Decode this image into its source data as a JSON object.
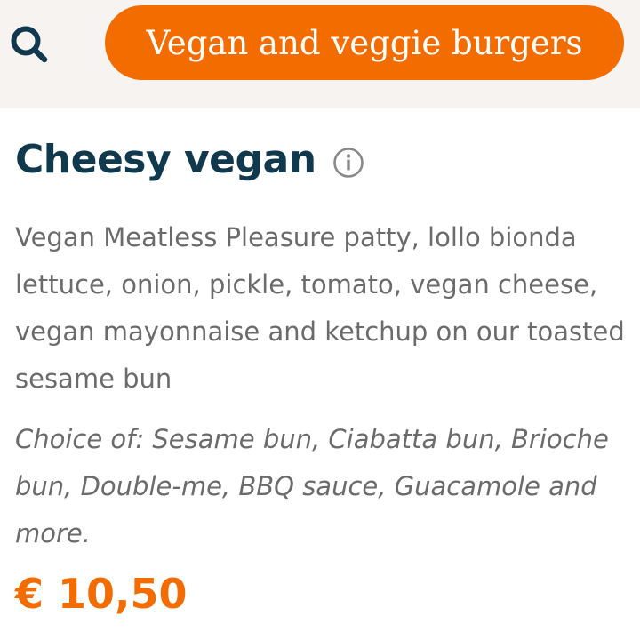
{
  "header": {
    "search_icon": "search-icon",
    "category_label": "Vegan and veggie burgers"
  },
  "product": {
    "name": "Cheesy vegan",
    "info_icon": "info-icon",
    "description": "Vegan Meatless Pleasure patty, lollo bionda lettuce, onion, pickle, tomato, vegan cheese, vegan mayonnaise and ketchup on our toasted sesame bun",
    "choices": "Choice of: Sesame bun, Ciabatta bun, Brioche bun, Double-me, BBQ sauce, Guacamole and more.",
    "price": "€ 10,50"
  },
  "colors": {
    "accent": "#f36c00",
    "title": "#11394e",
    "body_text": "#6b6b6b",
    "header_bg": "#f6f3f1"
  }
}
